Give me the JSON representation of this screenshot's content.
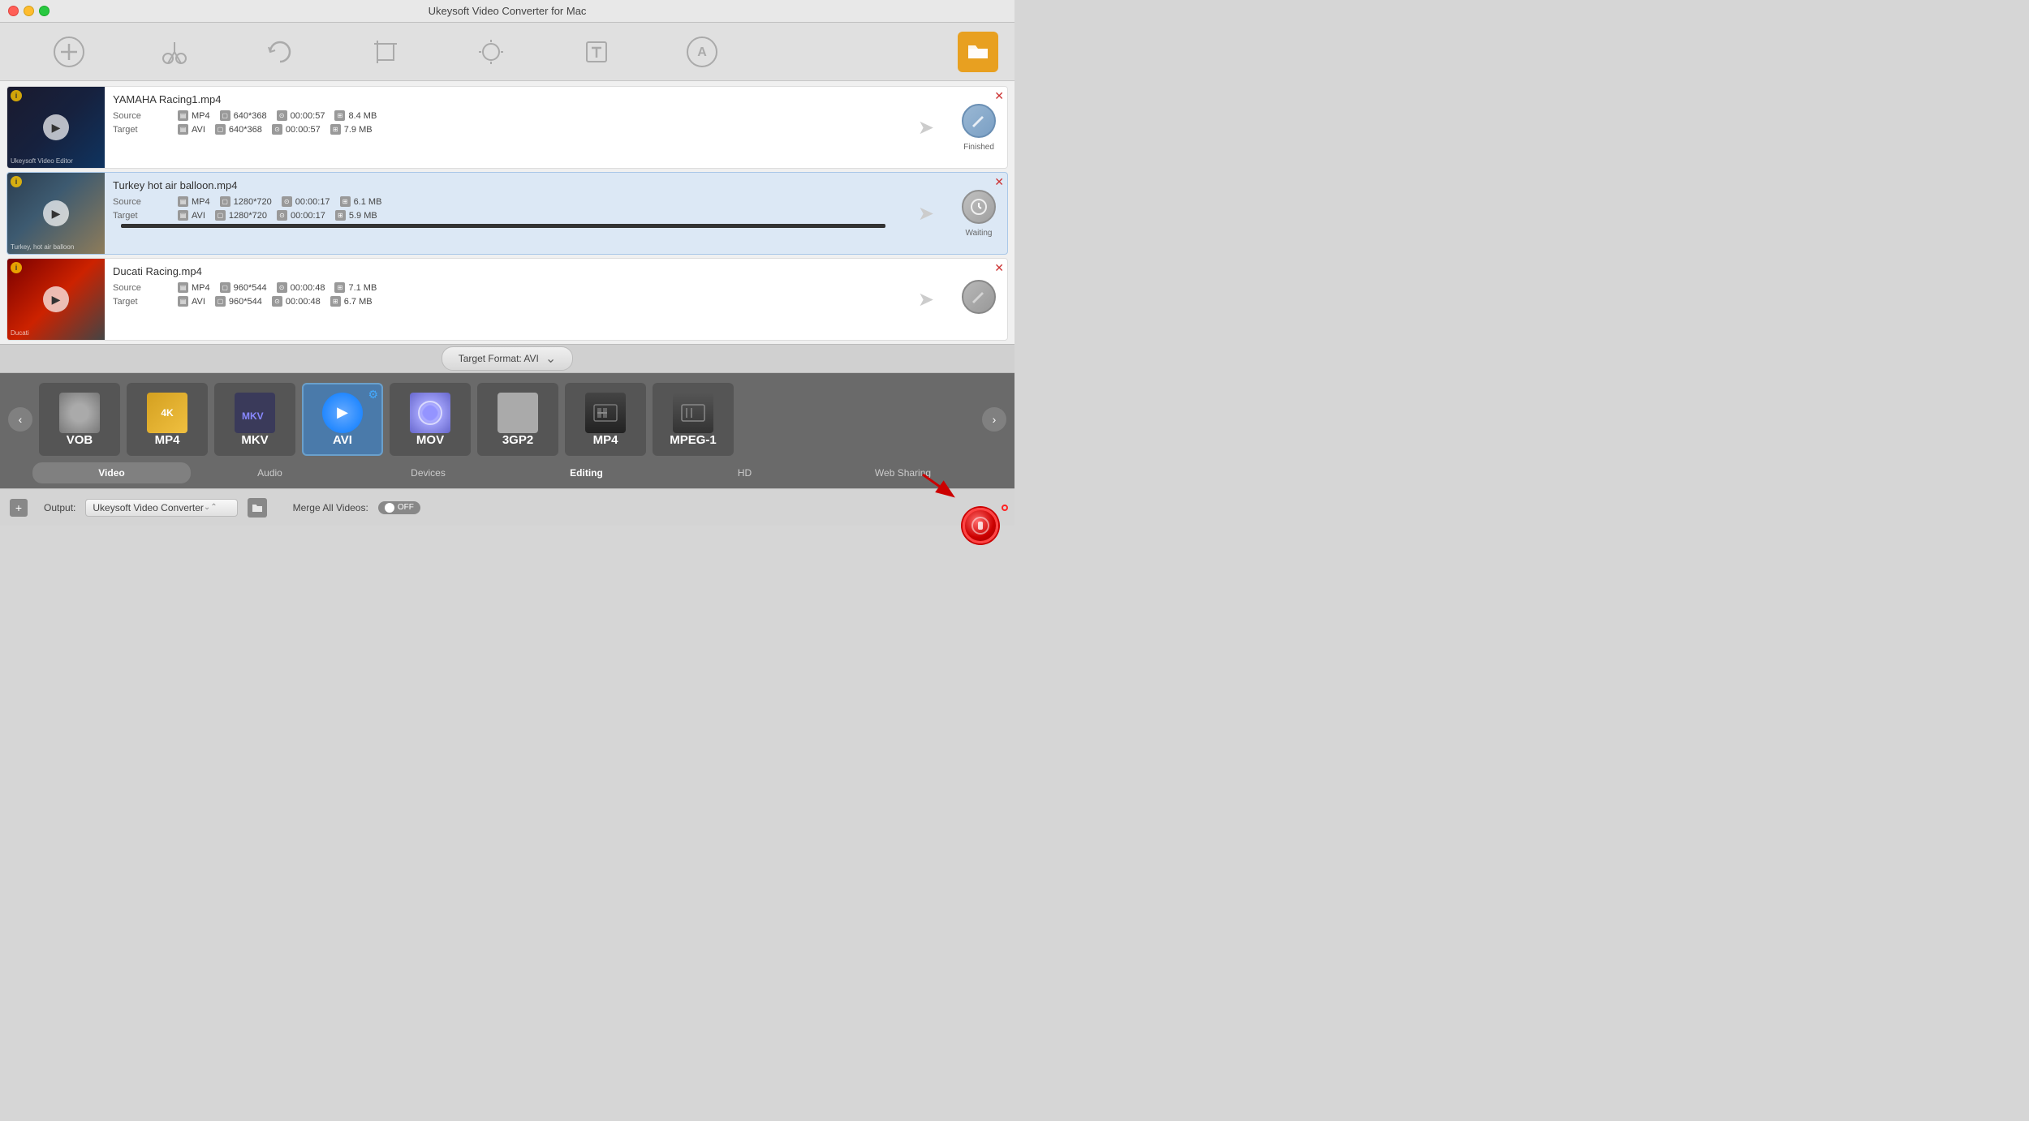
{
  "app": {
    "title": "Ukeysoft Video Converter for Mac"
  },
  "toolbar": {
    "buttons": [
      {
        "id": "add",
        "icon": "+",
        "label": ""
      },
      {
        "id": "cut",
        "icon": "✂",
        "label": ""
      },
      {
        "id": "rotate",
        "icon": "↺",
        "label": ""
      },
      {
        "id": "crop",
        "icon": "⊡",
        "label": ""
      },
      {
        "id": "effect",
        "icon": "✱",
        "label": ""
      },
      {
        "id": "watermark",
        "icon": "T",
        "label": ""
      },
      {
        "id": "audio",
        "icon": "A",
        "label": ""
      }
    ],
    "folder_icon": "📁"
  },
  "files": [
    {
      "id": "file1",
      "name": "YAMAHA Racing1.mp4",
      "thumbnail_type": "yamaha",
      "source": {
        "format": "MP4",
        "resolution": "640*368",
        "duration": "00:00:57",
        "size": "8.4 MB"
      },
      "target": {
        "format": "AVI",
        "resolution": "640*368",
        "duration": "00:00:57",
        "size": "7.9 MB"
      },
      "status": "Finished",
      "status_type": "finished"
    },
    {
      "id": "file2",
      "name": "Turkey hot air balloon.mp4",
      "thumbnail_type": "balloon",
      "source": {
        "format": "MP4",
        "resolution": "1280*720",
        "duration": "00:00:17",
        "size": "6.1 MB"
      },
      "target": {
        "format": "AVI",
        "resolution": "1280*720",
        "duration": "00:00:17",
        "size": "5.9 MB"
      },
      "status": "Waiting",
      "status_type": "waiting",
      "has_progress": true,
      "progress": 100
    },
    {
      "id": "file3",
      "name": "Ducati Racing.mp4",
      "thumbnail_type": "ducati",
      "source": {
        "format": "MP4",
        "resolution": "960*544",
        "duration": "00:00:48",
        "size": "7.1 MB"
      },
      "target": {
        "format": "AVI",
        "resolution": "960*544",
        "duration": "00:00:48",
        "size": "6.7 MB"
      },
      "status": "",
      "status_type": "pending"
    }
  ],
  "target_format_bar": {
    "label": "Target Format: AVI",
    "chevron": "⌄"
  },
  "formats": [
    {
      "id": "vob",
      "name": "VOB",
      "type": "vob"
    },
    {
      "id": "mp4-4k",
      "name": "MP4",
      "type": "mp4-4k",
      "sub": "4K"
    },
    {
      "id": "mkv",
      "name": "MKV",
      "type": "mkv"
    },
    {
      "id": "avi",
      "name": "AVI",
      "type": "avi",
      "selected": true,
      "has_gear": true
    },
    {
      "id": "mov",
      "name": "MOV",
      "type": "mov"
    },
    {
      "id": "3gp2",
      "name": "3GP2",
      "type": "3gp2"
    },
    {
      "id": "mp4-hd",
      "name": "MP4",
      "type": "mp4-hd"
    },
    {
      "id": "mpeg1",
      "name": "MPEG-1",
      "type": "mpeg1"
    }
  ],
  "format_tabs": [
    {
      "id": "video",
      "label": "Video",
      "active": true
    },
    {
      "id": "audio",
      "label": "Audio",
      "active": false
    },
    {
      "id": "devices",
      "label": "Devices",
      "active": false
    },
    {
      "id": "editing",
      "label": "Editing",
      "active": false
    },
    {
      "id": "hd",
      "label": "HD",
      "active": false
    },
    {
      "id": "web-sharing",
      "label": "Web Sharing",
      "active": false
    }
  ],
  "bottom_bar": {
    "output_label": "Output:",
    "output_value": "Ukeysoft Video Converter",
    "merge_label": "Merge All Videos:",
    "toggle_off": "OFF",
    "convert_btn_label": ""
  }
}
